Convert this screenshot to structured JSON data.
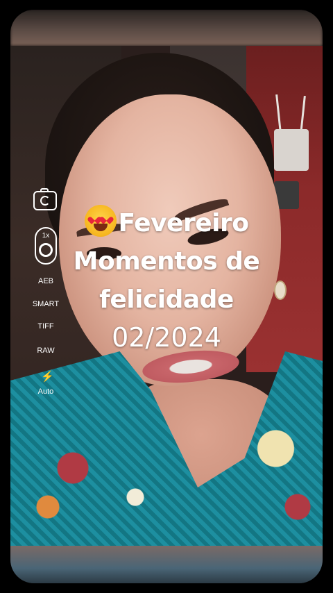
{
  "camera_controls": {
    "zoom_level": "1x",
    "modes": [
      "AEB",
      "SMART",
      "TIFF",
      "RAW"
    ],
    "flash_mode": "Auto",
    "icons": [
      "camera-switch-icon",
      "zoom-lens-icon",
      "flash-icon"
    ]
  },
  "caption": {
    "emoji": "heart-eyes-emoji",
    "line1": "Fevereiro",
    "line2": "Momentos de",
    "line3": "felicidade",
    "line4": "02/2024"
  }
}
